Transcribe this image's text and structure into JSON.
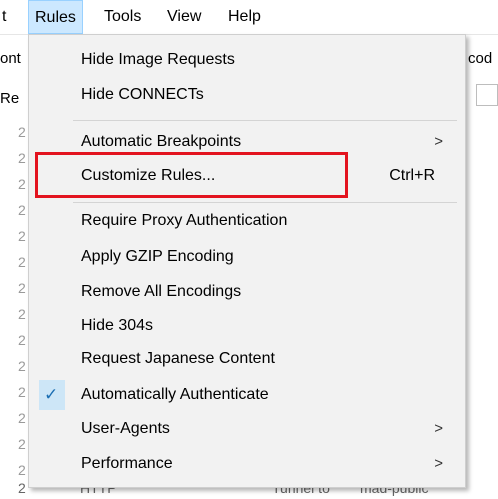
{
  "menubar": {
    "items": [
      {
        "label": "t"
      },
      {
        "label": "Rules"
      },
      {
        "label": "Tools"
      },
      {
        "label": "View"
      },
      {
        "label": "Help"
      }
    ]
  },
  "background": {
    "left_label_1": "ont",
    "right_label_1": "cod",
    "left_label_2": "Re",
    "row_number": "2",
    "bottom_text_1": "2",
    "bottom_text_2": "HTTP",
    "bottom_text_3": "Tunnel to",
    "bottom_text_4": "mad-public"
  },
  "rules_menu": {
    "items": [
      {
        "label": "Hide Image Requests"
      },
      {
        "label": "Hide CONNECTs"
      },
      {
        "label": "Automatic Breakpoints",
        "arrow": ">"
      },
      {
        "label": "Customize Rules...",
        "shortcut": "Ctrl+R"
      },
      {
        "label": "Require Proxy Authentication"
      },
      {
        "label": "Apply GZIP Encoding"
      },
      {
        "label": "Remove All Encodings"
      },
      {
        "label": "Hide 304s"
      },
      {
        "label": "Request Japanese Content"
      },
      {
        "label": "Automatically Authenticate",
        "checked": true,
        "check_glyph": "✓"
      },
      {
        "label": "User-Agents",
        "arrow": ">"
      },
      {
        "label": "Performance",
        "arrow": ">"
      }
    ]
  },
  "colors": {
    "menu_background": "#f2f2f2",
    "active_menubar_item": "#cce8ff",
    "highlight_box": "#e3141f",
    "check_background": "#cde6f7"
  }
}
